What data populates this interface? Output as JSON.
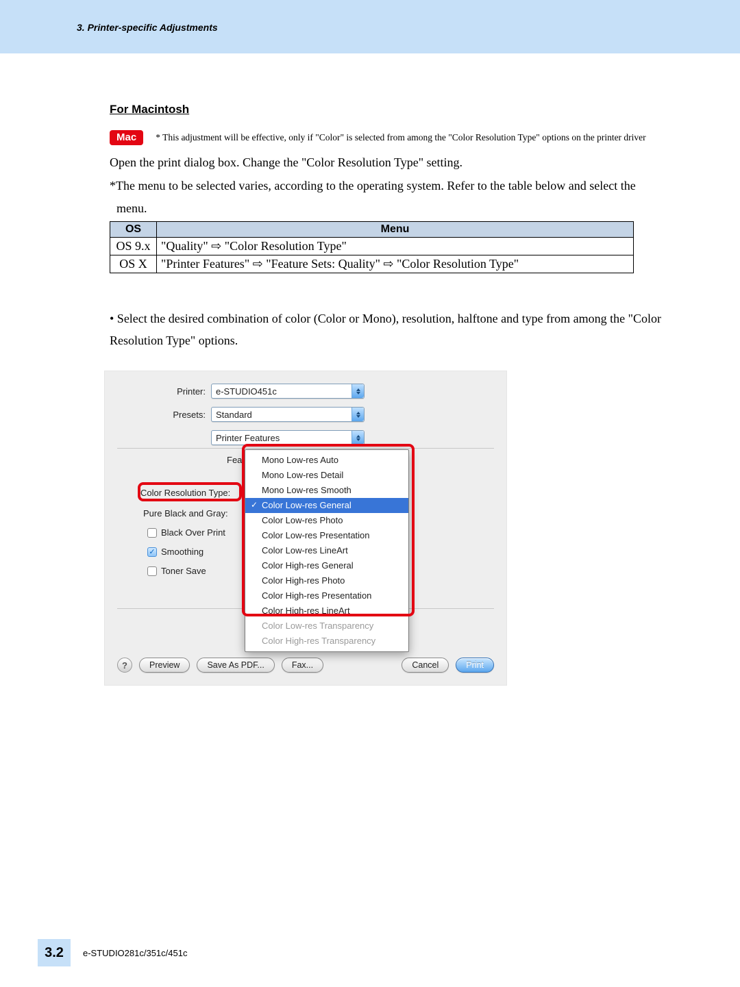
{
  "header": {
    "chapter": "3. Printer-specific Adjustments"
  },
  "section_heading": "For Macintosh",
  "mac_badge": "Mac",
  "mac_note": "* This adjustment will be effective, only if \"Color\" is selected from among the \"Color Resolution Type\" options on the printer driver",
  "p1": "Open the print dialog box.  Change the \"Color Resolution Type\" setting.",
  "p2_a": "*",
  "p2_b": "The menu to be selected varies, according to the operating system. Refer to the table below and select the",
  "p2_c": "menu.",
  "table": {
    "headers": {
      "os": "OS",
      "menu": "Menu"
    },
    "rows": [
      {
        "os": "OS 9.x",
        "menu": "\"Quality\" ⇨ \"Color Resolution Type\""
      },
      {
        "os": "OS X",
        "menu": "\"Printer Features\" ⇨ \"Feature Sets: Quality\" ⇨ \"Color Resolution Type\""
      }
    ]
  },
  "bullet": "• Select the desired combination of color (Color or Mono), resolution, halftone and type from among the \"Color Resolution Type\" options.",
  "dialog": {
    "labels": {
      "printer": "Printer:",
      "presets": "Presets:",
      "fea_stub": "Fea",
      "crt": "Color Resolution Type:",
      "pbg": "Pure Black and Gray:",
      "bop": "Black Over Print",
      "smoothing": "Smoothing",
      "toner": "Toner Save"
    },
    "values": {
      "printer": "e-STUDIO451c",
      "presets": "Standard",
      "section": "Printer Features"
    },
    "dropdown": {
      "options": [
        "Mono Low-res Auto",
        "Mono Low-res Detail",
        "Mono Low-res Smooth",
        "Color Low-res General",
        "Color Low-res Photo",
        "Color Low-res Presentation",
        "Color Low-res LineArt",
        "Color High-res General",
        "Color High-res Photo",
        "Color High-res Presentation",
        "Color High-res LineArt",
        "Color Low-res Transparency",
        "Color High-res Transparency"
      ],
      "selected_index": 3,
      "disabled_indices": [
        11,
        12
      ]
    },
    "buttons": {
      "help": "?",
      "preview": "Preview",
      "save_pdf": "Save As PDF...",
      "fax": "Fax...",
      "cancel": "Cancel",
      "print": "Print"
    }
  },
  "footer": {
    "section_number": "3.2",
    "model": "e-STUDIO281c/351c/451c"
  }
}
